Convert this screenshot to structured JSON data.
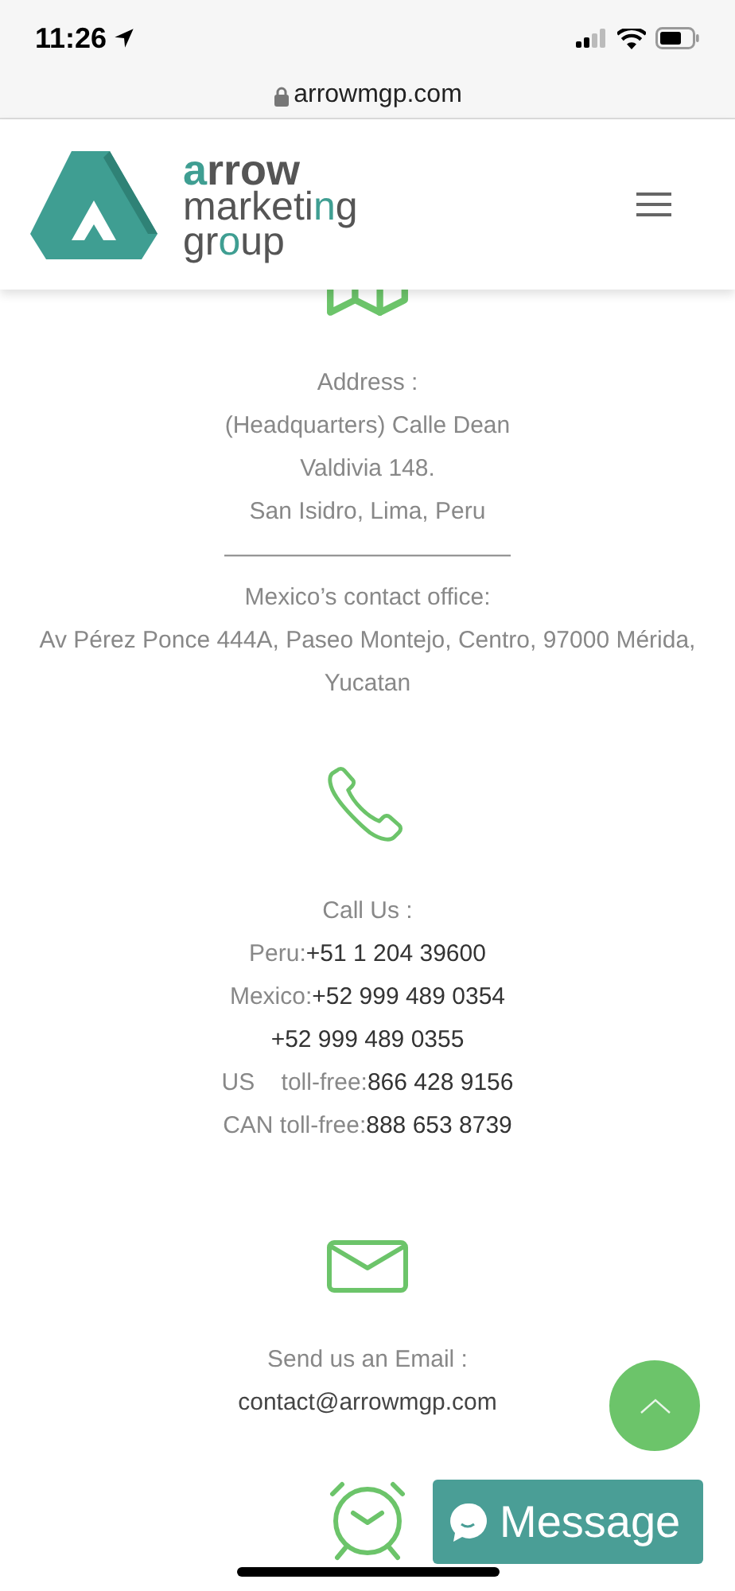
{
  "status_bar": {
    "time": "11:26"
  },
  "browser": {
    "url": "arrowmgp.com"
  },
  "logo": {
    "lines": [
      [
        {
          "text": "a",
          "accent": true
        },
        {
          "text": "rrow",
          "accent": false
        }
      ],
      [
        {
          "text": "marketi",
          "accent": false
        },
        {
          "text": "n",
          "accent": true
        },
        {
          "text": "g",
          "accent": false
        }
      ],
      [
        {
          "text": "gr",
          "accent": false
        },
        {
          "text": "o",
          "accent": true
        },
        {
          "text": "up",
          "accent": false
        }
      ]
    ]
  },
  "sections": [
    {
      "kind": "map",
      "lines": [
        {
          "text": "Address :"
        },
        {
          "text": "(Headquarters) Calle Dean"
        },
        {
          "text": "Valdivia 148."
        },
        {
          "text": "San Isidro, Lima, Peru"
        },
        {
          "text": "————————————"
        },
        {
          "text": "Mexico’s contact office:"
        },
        {
          "text": "Av Pérez Ponce 444A, Paseo Montejo, Centro, 97000 Mérida, Yucatan"
        }
      ]
    },
    {
      "kind": "phone",
      "lines": [
        {
          "text": "Call Us :"
        },
        {
          "label": "Peru:",
          "value": "+51 1 204 39600"
        },
        {
          "label": "Mexico:",
          "value": "+52 999 489 0354"
        },
        {
          "value": "+52 999 489 0355"
        },
        {
          "label": "US    toll-free:",
          "value": "866 428 9156"
        },
        {
          "label": "CAN toll-free:",
          "value": "888 653 8739"
        }
      ]
    },
    {
      "kind": "mail",
      "lines": [
        {
          "text": "Send us an Email :"
        },
        {
          "link": "contact@arrowmgp.com"
        }
      ]
    },
    {
      "kind": "clock"
    }
  ],
  "message_button": {
    "label": "Message"
  }
}
